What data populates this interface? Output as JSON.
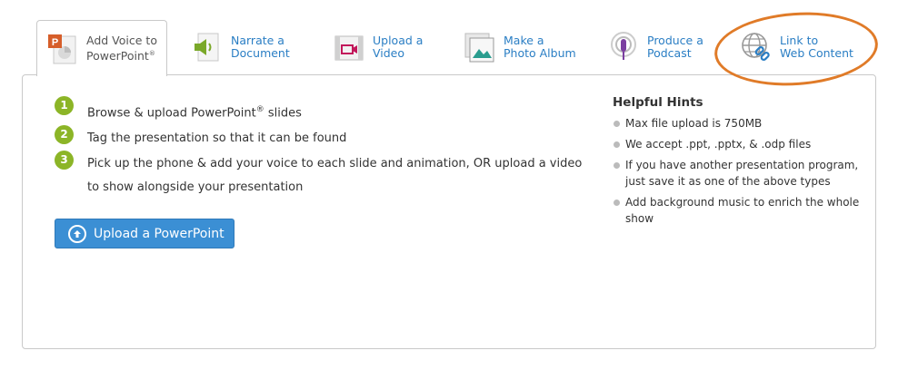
{
  "tabs": [
    {
      "label": "Add Voice to\nPowerPoint",
      "sup": "®",
      "icon": "powerpoint-icon",
      "active": true
    },
    {
      "label": "Narrate a\nDocument",
      "icon": "document-speaker-icon",
      "active": false
    },
    {
      "label": "Upload a\nVideo",
      "icon": "film-icon",
      "active": false
    },
    {
      "label": "Make a\nPhoto Album",
      "icon": "photo-album-icon",
      "active": false
    },
    {
      "label": "Produce a\nPodcast",
      "icon": "microphone-icon",
      "active": false
    },
    {
      "label": "Link to\nWeb Content",
      "icon": "globe-link-icon",
      "active": false
    }
  ],
  "steps": [
    {
      "num": "1",
      "text": "Browse & upload PowerPoint",
      "sup": "®",
      "text_after": " slides"
    },
    {
      "num": "2",
      "text": "Tag the presentation so that it can be found"
    },
    {
      "num": "3",
      "text": "Pick up the phone & add your voice to each slide and animation, OR upload a video to show alongside your presentation"
    }
  ],
  "upload_button": {
    "label": "Upload a PowerPoint"
  },
  "hints": {
    "title": "Helpful Hints",
    "items": [
      "Max file upload is 750MB",
      "We accept .ppt, .pptx, & .odp files",
      "If you have another presentation program, just save it as one of the above types",
      "Add background music to enrich the whole show"
    ]
  },
  "colors": {
    "accent": "#2a7ec4",
    "step_green": "#8cb527",
    "button_blue": "#3b8fd4",
    "highlight_orange": "#e07b28"
  }
}
